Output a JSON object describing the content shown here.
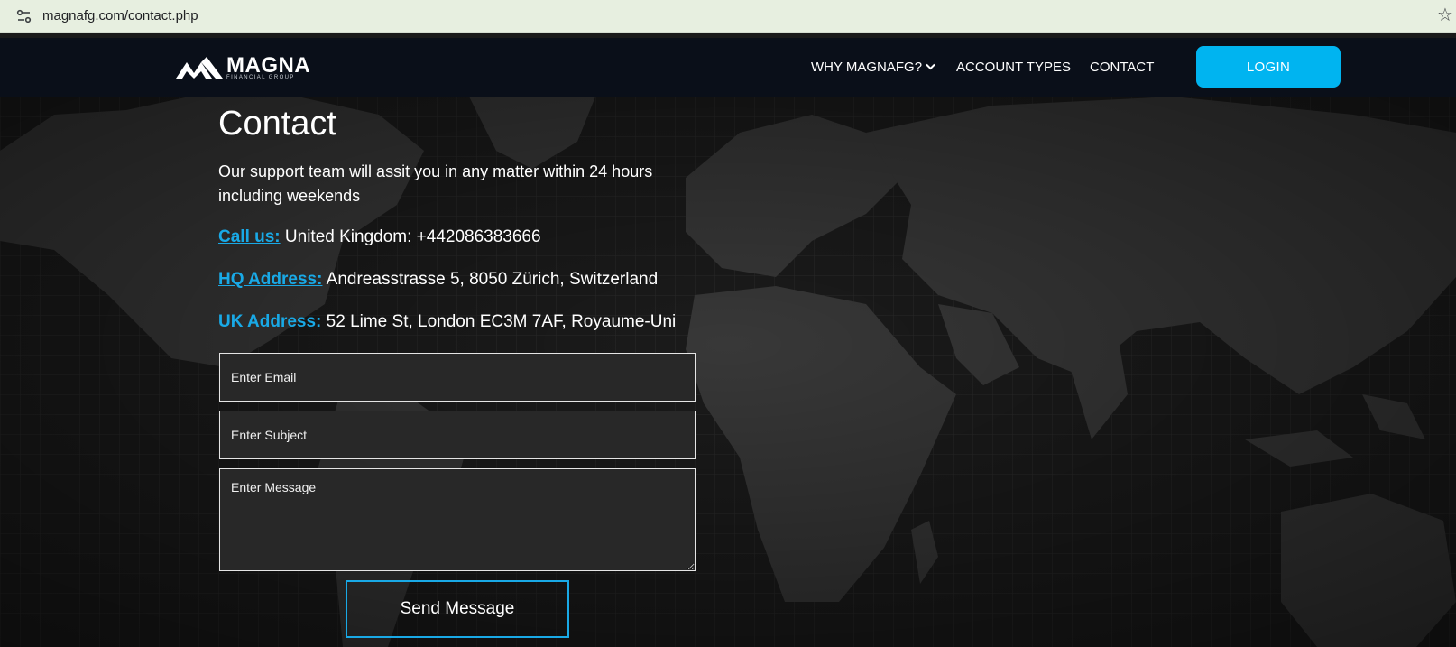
{
  "browser": {
    "url": "magnafg.com/contact.php",
    "icons": [
      "tune-icon",
      "star-icon"
    ]
  },
  "header": {
    "logo_text": "MAGNA",
    "logo_subtext": "FINANCIAL GROUP",
    "nav": {
      "why": "WHY MAGNAFG?",
      "account_types": "ACCOUNT TYPES",
      "contact": "CONTACT"
    },
    "login": "LOGIN",
    "colors": {
      "header_bg": "#0a0f19",
      "accent": "#00b4f0"
    }
  },
  "main": {
    "title": "Contact",
    "intro": "Our support team will assit you in any matter within 24 hours including weekends",
    "call": {
      "label": "Call us:",
      "value": "United Kingdom: +442086383666"
    },
    "hq": {
      "label": "HQ Address:",
      "value": "Andreasstrasse 5, 8050 Zürich, Switzerland"
    },
    "uk": {
      "label": "UK Address:",
      "value": "52 Lime St, London EC3M 7AF, Royaume-Uni"
    },
    "form": {
      "email_placeholder": "Enter Email",
      "subject_placeholder": "Enter Subject",
      "message_placeholder": "Enter Message",
      "submit": "Send Message"
    },
    "link_color": "#19a9e6"
  }
}
